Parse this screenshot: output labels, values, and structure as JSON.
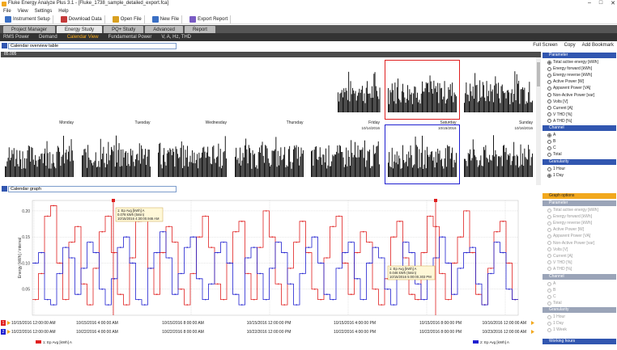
{
  "window": {
    "title": "Fluke Energy Analyze Plus 3.1 - [Fluke_1738_sample_detailed_export.fca]",
    "controls": [
      "–",
      "□",
      "✕"
    ]
  },
  "menu": [
    "File",
    "View",
    "Settings",
    "Help"
  ],
  "toolbar": [
    {
      "label": "Instrument Setup",
      "icon": "wrench-icon",
      "color": "#3a6fc4"
    },
    {
      "label": "Download Data",
      "icon": "download-icon",
      "color": "#c43a3a"
    },
    {
      "label": "Open File",
      "icon": "folder-icon",
      "color": "#d9a020"
    },
    {
      "label": "New File",
      "icon": "new-file-icon",
      "color": "#3a6fc4"
    },
    {
      "label": "Export Report",
      "icon": "report-icon",
      "color": "#7a5cc4"
    }
  ],
  "main_tabs": [
    "Project Manager",
    "Energy Study",
    "PQ+ Study",
    "Advanced",
    "Report"
  ],
  "main_tabs_active": 1,
  "sub_tabs": [
    "RMS Power",
    "Demand",
    "Calendar View",
    "Fundamental Power",
    "V, A, Hz, THD"
  ],
  "sub_tabs_active": 2,
  "calendar_table": {
    "field_value": "Calendar overview table",
    "header": "85.005",
    "right_actions": [
      "Full Screen",
      "Copy",
      "Add Bookmark"
    ],
    "rows": [
      {
        "days": [
          "Monday",
          "Tuesday",
          "Wednesday",
          "Thursday",
          "Friday",
          "Saturday",
          "Sunday"
        ],
        "dates": [
          "",
          "",
          "",
          "",
          "10/14/2016",
          "10/15/2016",
          "10/16/2016"
        ]
      },
      {
        "days": [
          "Monday",
          "Tuesday",
          "Wednesday",
          "Thursday",
          "Friday",
          "Saturday",
          "Sunday"
        ],
        "dates": [
          "",
          "",
          "",
          "",
          "",
          "",
          ""
        ]
      }
    ]
  },
  "calendar_graph": {
    "field_value": "Calendar graph"
  },
  "side_panel_top": {
    "parameter_header": "Parameter",
    "parameters": [
      "Total active energy [kWh]",
      "Energy forward [kWh]",
      "Energy reverse [kWh]",
      "Active Power [W]",
      "Apparent Power [VA]",
      "Non-Active Power [var]",
      "Volts [V]",
      "Current [A]",
      "V THD [%]",
      "A THD [%]"
    ],
    "parameter_selected": 0,
    "channel_header": "Channel",
    "channels": [
      "A",
      "B",
      "C",
      "Total"
    ],
    "channel_selected": 0,
    "granularity_header": "Granularity",
    "granularities": [
      "1 Hour",
      "1 Day"
    ],
    "granularity_selected": 1
  },
  "side_panel_bottom": {
    "graph_options_header": "Graph options",
    "parameter_header": "Parameter",
    "parameters": [
      "Total active energy [kWh]",
      "Energy forward [kWh]",
      "Energy reverse [kWh]",
      "Active Power [W]",
      "Apparent Power [VA]",
      "Non-Active Power [var]",
      "Volts [V]",
      "Current [A]",
      "V THD [%]",
      "A THD [%]"
    ],
    "channel_header": "Channel",
    "channels": [
      "A",
      "B",
      "C",
      "Total"
    ],
    "granularity_header": "Granularity",
    "granularities": [
      "1 Hour",
      "1 Day",
      "1 Week"
    ],
    "working_hours_header": "Working hours"
  },
  "colors": {
    "red": "#e02020",
    "blue": "#2020d0",
    "accent_blue": "#3156b0",
    "orange": "#f2a81d"
  },
  "chart_data": {
    "type": "line",
    "ylabel": "Energy [kWh] / interval",
    "ylim": [
      0,
      0.22
    ],
    "y_ticks": [
      "0.20",
      "0.15",
      "0.10",
      "0.05"
    ],
    "x_ticks": [
      "10/15/2016 12:00:00 AM",
      "10/15/2016 4:00:00 AM",
      "10/15/2016 8:00:00 AM",
      "10/15/2016 12:00:00 PM",
      "10/15/2016 4:00:00 PM",
      "10/15/2016 8:00:00 PM",
      "10/16/2016 12:00:00 AM"
    ],
    "x_ticks_b": [
      "10/22/2016 12:00:00 AM",
      "10/22/2016 4:00:00 AM",
      "10/22/2016 8:00:00 AM",
      "10/22/2016 12:00:00 PM",
      "10/22/2016 4:00:00 PM",
      "10/22/2016 8:00:00 PM",
      "10/23/2016 12:00:00 AM"
    ],
    "series": [
      {
        "name": "1: Ep Avg [kWh] A",
        "color": "#e02020",
        "values": [
          0.03,
          0.08,
          0.19,
          0.21,
          0.1,
          0.03,
          0.14,
          0.17,
          0.06,
          0.02,
          0.09,
          0.16,
          0.19,
          0.12,
          0.04,
          0.02,
          0.11,
          0.18,
          0.2,
          0.09,
          0.04,
          0.12,
          0.17,
          0.14,
          0.05,
          0.02,
          0.08,
          0.15,
          0.19,
          0.13,
          0.06,
          0.03,
          0.1,
          0.16,
          0.18,
          0.08,
          0.03,
          0.13,
          0.2,
          0.15,
          0.06,
          0.02,
          0.09,
          0.14,
          0.18,
          0.12,
          0.05,
          0.03,
          0.11,
          0.17,
          0.19,
          0.1,
          0.04,
          0.12,
          0.16,
          0.14,
          0.05,
          0.02,
          0.07,
          0.15,
          0.18,
          0.11,
          0.04,
          0.03,
          0.12,
          0.19,
          0.17,
          0.08,
          0.03,
          0.1,
          0.15,
          0.2,
          0.12,
          0.04,
          0.02,
          0.09,
          0.16,
          0.18,
          0.1,
          0.03
        ]
      },
      {
        "name": "2: Ep Avg [kWh] A",
        "color": "#2020d0",
        "values": [
          0.1,
          0.12,
          0.03,
          0.02,
          0.08,
          0.13,
          0.11,
          0.04,
          0.09,
          0.14,
          0.12,
          0.05,
          0.02,
          0.07,
          0.13,
          0.15,
          0.1,
          0.03,
          0.02,
          0.09,
          0.12,
          0.16,
          0.11,
          0.04,
          0.08,
          0.13,
          0.15,
          0.07,
          0.03,
          0.06,
          0.12,
          0.14,
          0.1,
          0.04,
          0.02,
          0.11,
          0.13,
          0.08,
          0.03,
          0.09,
          0.14,
          0.12,
          0.06,
          0.02,
          0.08,
          0.13,
          0.15,
          0.1,
          0.04,
          0.03,
          0.09,
          0.12,
          0.14,
          0.07,
          0.03,
          0.1,
          0.13,
          0.11,
          0.05,
          0.02,
          0.08,
          0.14,
          0.12,
          0.06,
          0.03,
          0.07,
          0.11,
          0.15,
          0.1,
          0.04,
          0.09,
          0.12,
          0.13,
          0.06,
          0.02,
          0.08,
          0.14,
          0.12,
          0.05,
          0.03
        ]
      }
    ],
    "tooltip1": {
      "title": "1: Ep Avg [kWh] A",
      "line1": "0.078 kWh (5min)",
      "line2": "10/15/2016 4:30:00.946 AM"
    },
    "tooltip2": {
      "title": "1: Ep Avg [kWh] A",
      "line1": "0.046 kWh (5min)",
      "line2": "10/15/2016 5:00:00.303 PM"
    },
    "row_labels": [
      "1",
      "2"
    ],
    "legend": [
      "1: Ep Avg [kWh] A",
      "2: Ep Avg [kWh] A"
    ]
  }
}
